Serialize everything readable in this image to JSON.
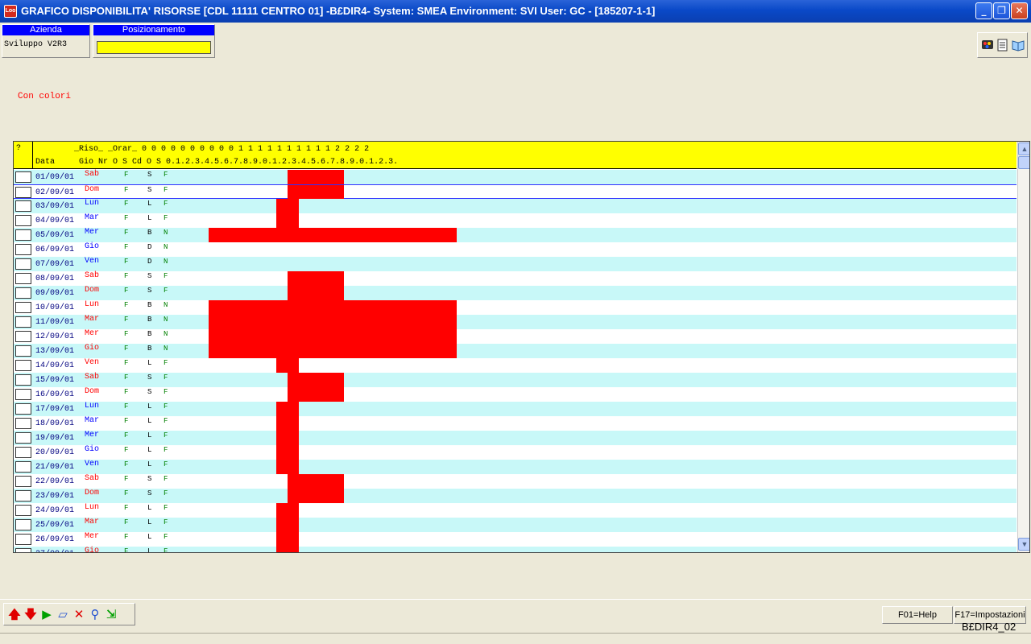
{
  "window": {
    "title": "GRAFICO DISPONIBILITA' RISORSE [CDL  11111  CENTRO 01] -B£DIR4- System: SMEA Environment: SVI User: GC - [185207-1-1]",
    "app_icon": "app-logo-icon"
  },
  "header": {
    "azienda_label": "Azienda",
    "azienda_value": "Sviluppo V2R3",
    "posizionamento_label": "Posizionamento",
    "posizionamento_value": ""
  },
  "toolbar_icons": [
    "color-palette-icon",
    "document-icon",
    "book-icon"
  ],
  "page": {
    "con_colori": "Con colori"
  },
  "grid": {
    "select_header": "?",
    "header_line1": "        _Riso_ _Orar_ 0 0 0 0 0 0 0 0 0 0 1 1 1 1 1 1 1 1 1 1 2 2 2 2",
    "header_line2": "Data     Gio Nr O S Cd O S 0.1.2.3.4.5.6.7.8.9.0.1.2.3.4.5.6.7.8.9.0.1.2.3.",
    "colors": {
      "odd": "#c8f8f8",
      "even": "#ffffff",
      "busy": "#ff0000",
      "weekend": "#ff0000",
      "weekday": "#0000ff",
      "header": "#ffff00"
    },
    "rows": [
      {
        "date": "01/09/01",
        "day": "Sab",
        "o": "F",
        "cd": "S",
        "s": "F",
        "from": 8,
        "to": 13
      },
      {
        "date": "02/09/01",
        "day": "Dom",
        "o": "F",
        "cd": "S",
        "s": "F",
        "from": 8,
        "to": 13
      },
      {
        "date": "03/09/01",
        "day": "Lun",
        "o": "F",
        "cd": "L",
        "s": "F",
        "from": 7,
        "to": 9
      },
      {
        "date": "04/09/01",
        "day": "Mar",
        "o": "F",
        "cd": "L",
        "s": "F",
        "from": 7,
        "to": 9
      },
      {
        "date": "05/09/01",
        "day": "Mer",
        "o": "F",
        "cd": "B",
        "s": "N",
        "from": 1,
        "to": 23
      },
      {
        "date": "06/09/01",
        "day": "Gio",
        "o": "F",
        "cd": "D",
        "s": "N",
        "from": null,
        "to": null
      },
      {
        "date": "07/09/01",
        "day": "Ven",
        "o": "F",
        "cd": "D",
        "s": "N",
        "from": null,
        "to": null
      },
      {
        "date": "08/09/01",
        "day": "Sab",
        "o": "F",
        "cd": "S",
        "s": "F",
        "from": 8,
        "to": 13
      },
      {
        "date": "09/09/01",
        "day": "Dom",
        "o": "F",
        "cd": "S",
        "s": "F",
        "from": 8,
        "to": 13
      },
      {
        "date": "10/09/01",
        "day": "Lun",
        "o": "F",
        "cd": "B",
        "s": "N",
        "from": 1,
        "to": 23
      },
      {
        "date": "11/09/01",
        "day": "Mar",
        "o": "F",
        "cd": "B",
        "s": "N",
        "from": 1,
        "to": 23
      },
      {
        "date": "12/09/01",
        "day": "Mer",
        "o": "F",
        "cd": "B",
        "s": "N",
        "from": 1,
        "to": 23
      },
      {
        "date": "13/09/01",
        "day": "Gio",
        "o": "F",
        "cd": "B",
        "s": "N",
        "from": 1,
        "to": 23
      },
      {
        "date": "14/09/01",
        "day": "Ven",
        "o": "F",
        "cd": "L",
        "s": "F",
        "from": 7,
        "to": 9
      },
      {
        "date": "15/09/01",
        "day": "Sab",
        "o": "F",
        "cd": "S",
        "s": "F",
        "from": 8,
        "to": 13
      },
      {
        "date": "16/09/01",
        "day": "Dom",
        "o": "F",
        "cd": "S",
        "s": "F",
        "from": 8,
        "to": 13
      },
      {
        "date": "17/09/01",
        "day": "Lun",
        "o": "F",
        "cd": "L",
        "s": "F",
        "from": 7,
        "to": 9
      },
      {
        "date": "18/09/01",
        "day": "Mar",
        "o": "F",
        "cd": "L",
        "s": "F",
        "from": 7,
        "to": 9
      },
      {
        "date": "19/09/01",
        "day": "Mer",
        "o": "F",
        "cd": "L",
        "s": "F",
        "from": 7,
        "to": 9
      },
      {
        "date": "20/09/01",
        "day": "Gio",
        "o": "F",
        "cd": "L",
        "s": "F",
        "from": 7,
        "to": 9
      },
      {
        "date": "21/09/01",
        "day": "Ven",
        "o": "F",
        "cd": "L",
        "s": "F",
        "from": 7,
        "to": 9
      },
      {
        "date": "22/09/01",
        "day": "Sab",
        "o": "F",
        "cd": "S",
        "s": "F",
        "from": 8,
        "to": 13
      },
      {
        "date": "23/09/01",
        "day": "Dom",
        "o": "F",
        "cd": "S",
        "s": "F",
        "from": 8,
        "to": 13
      },
      {
        "date": "24/09/01",
        "day": "Lun",
        "o": "F",
        "cd": "L",
        "s": "F",
        "from": 7,
        "to": 9
      },
      {
        "date": "25/09/01",
        "day": "Mar",
        "o": "F",
        "cd": "L",
        "s": "F",
        "from": 7,
        "to": 9
      },
      {
        "date": "26/09/01",
        "day": "Mer",
        "o": "F",
        "cd": "L",
        "s": "F",
        "from": 7,
        "to": 9
      },
      {
        "date": "27/09/01",
        "day": "Gio",
        "o": "F",
        "cd": "L",
        "s": "F",
        "from": 7,
        "to": 9
      }
    ]
  },
  "bottom": {
    "nav_icons": [
      "arrow-up-icon",
      "arrow-down-icon",
      "play-icon",
      "eraser-icon",
      "delete-icon",
      "search-icon",
      "exit-icon"
    ],
    "f01_label": "F01=Help",
    "f17_label": "F17=Impostazioni",
    "program_code": "B£DIR4_02"
  }
}
